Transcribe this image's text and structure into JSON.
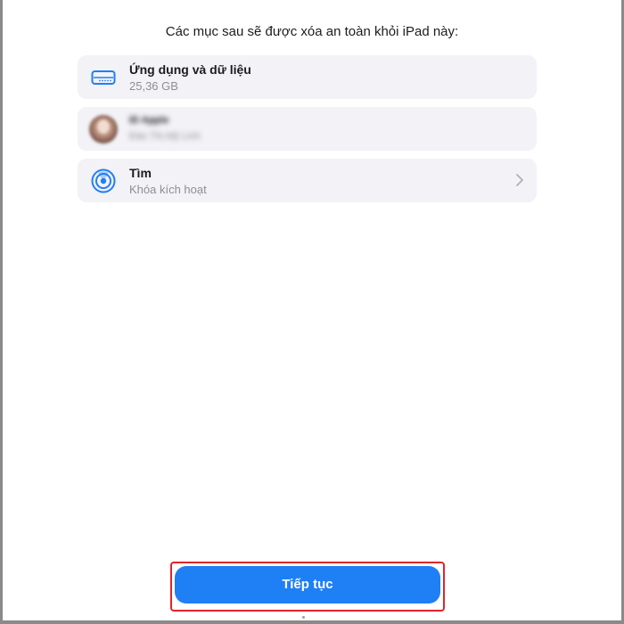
{
  "heading": "Các mục sau sẽ được xóa an toàn khỏi iPad này:",
  "items": [
    {
      "title": "Ứng dụng và dữ liệu",
      "subtitle": "25,36 GB",
      "icon": "storage-drive-icon"
    },
    {
      "title": "ID Apple",
      "subtitle": "Đào Thị Mỹ Linh",
      "icon": "avatar"
    },
    {
      "title": "Tìm",
      "subtitle": "Khóa kích hoạt",
      "icon": "find-my-icon"
    }
  ],
  "continue_button": {
    "label": "Tiếp tục"
  },
  "colors": {
    "accent": "#1f7ff5",
    "card_background": "#f2f2f7",
    "highlight_border": "#e0242b"
  }
}
